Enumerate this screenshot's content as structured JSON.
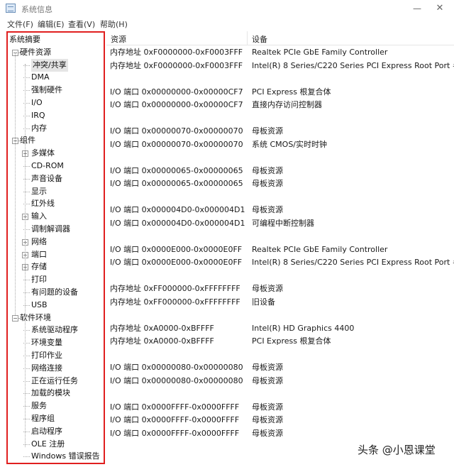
{
  "window": {
    "title": "系统信息",
    "minimize": "—",
    "close": "✕"
  },
  "menu": [
    "文件(F)",
    "编辑(E)",
    "查看(V)",
    "帮助(H)"
  ],
  "tree": {
    "root": "系统摘要",
    "hardware": {
      "label": "硬件资源",
      "items": [
        "冲突/共享",
        "DMA",
        "强制硬件",
        "I/O",
        "IRQ",
        "内存"
      ]
    },
    "components": {
      "label": "组件",
      "items": [
        "多媒体",
        "CD-ROM",
        "声音设备",
        "显示",
        "红外线",
        "输入",
        "调制解调器",
        "网络",
        "端口",
        "存储",
        "打印",
        "有问题的设备",
        "USB"
      ]
    },
    "software": {
      "label": "软件环境",
      "items": [
        "系统驱动程序",
        "环境变量",
        "打印作业",
        "网络连接",
        "正在运行任务",
        "加载的模块",
        "服务",
        "程序组",
        "启动程序",
        "OLE 注册",
        "Windows 错误报告"
      ]
    }
  },
  "table": {
    "columns": [
      "资源",
      "设备"
    ],
    "rows": [
      {
        "resource": "内存地址 0xF0000000-0xF0003FFF",
        "device": "Realtek PCIe GbE Family Controller"
      },
      {
        "resource": "内存地址 0xF0000000-0xF0003FFF",
        "device": "Intel(R) 8 Series/C220 Series PCI Express Root Port #6 - 8"
      },
      {
        "resource": "",
        "device": ""
      },
      {
        "resource": "I/O 端口 0x00000000-0x00000CF7",
        "device": "PCI Express 根复合体"
      },
      {
        "resource": "I/O 端口 0x00000000-0x00000CF7",
        "device": "直接内存访问控制器"
      },
      {
        "resource": "",
        "device": ""
      },
      {
        "resource": "I/O 端口 0x00000070-0x00000070",
        "device": "母板资源"
      },
      {
        "resource": "I/O 端口 0x00000070-0x00000070",
        "device": "系统 CMOS/实时时钟"
      },
      {
        "resource": "",
        "device": ""
      },
      {
        "resource": "I/O 端口 0x00000065-0x00000065",
        "device": "母板资源"
      },
      {
        "resource": "I/O 端口 0x00000065-0x00000065",
        "device": "母板资源"
      },
      {
        "resource": "",
        "device": ""
      },
      {
        "resource": "I/O 端口 0x000004D0-0x000004D1",
        "device": "母板资源"
      },
      {
        "resource": "I/O 端口 0x000004D0-0x000004D1",
        "device": "可编程中断控制器"
      },
      {
        "resource": "",
        "device": ""
      },
      {
        "resource": "I/O 端口 0x0000E000-0x0000E0FF",
        "device": "Realtek PCIe GbE Family Controller"
      },
      {
        "resource": "I/O 端口 0x0000E000-0x0000E0FF",
        "device": "Intel(R) 8 Series/C220 Series PCI Express Root Port #6 - 8"
      },
      {
        "resource": "",
        "device": ""
      },
      {
        "resource": "内存地址 0xFF000000-0xFFFFFFFF",
        "device": "母板资源"
      },
      {
        "resource": "内存地址 0xFF000000-0xFFFFFFFF",
        "device": "旧设备"
      },
      {
        "resource": "",
        "device": ""
      },
      {
        "resource": "内存地址 0xA0000-0xBFFFF",
        "device": "Intel(R) HD Graphics 4400"
      },
      {
        "resource": "内存地址 0xA0000-0xBFFFF",
        "device": "PCI Express 根复合体"
      },
      {
        "resource": "",
        "device": ""
      },
      {
        "resource": "I/O 端口 0x00000080-0x00000080",
        "device": "母板资源"
      },
      {
        "resource": "I/O 端口 0x00000080-0x00000080",
        "device": "母板资源"
      },
      {
        "resource": "",
        "device": ""
      },
      {
        "resource": "I/O 端口 0x0000FFFF-0x0000FFFF",
        "device": "母板资源"
      },
      {
        "resource": "I/O 端口 0x0000FFFF-0x0000FFFF",
        "device": "母板资源"
      },
      {
        "resource": "I/O 端口 0x0000FFFF-0x0000FFFF",
        "device": "母板资源"
      }
    ]
  },
  "watermark": "头条 @小恩课堂",
  "colors": {
    "highlight_border": "#e01f1f",
    "selection_bg": "#e5e5e5"
  }
}
